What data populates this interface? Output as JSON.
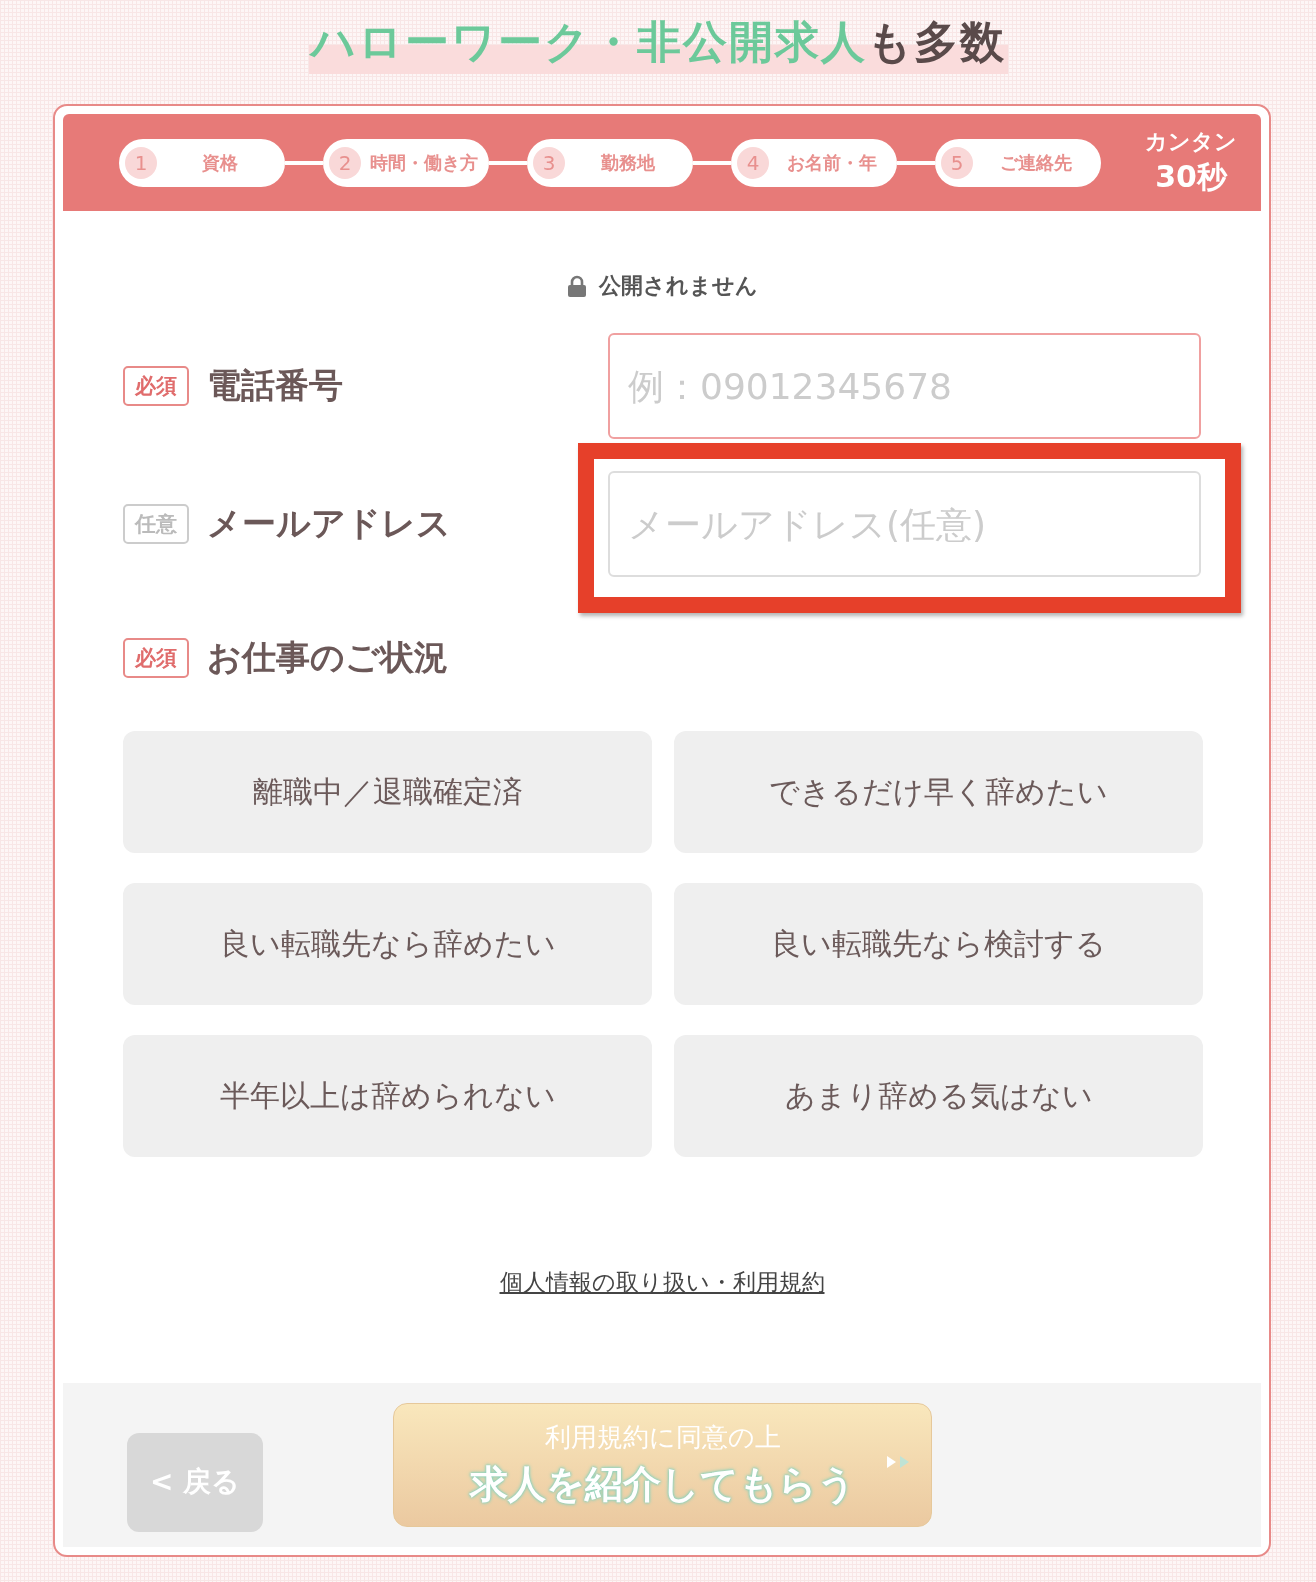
{
  "headline": {
    "highlight": "ハローワーク・非公開求人",
    "rest": "も多数"
  },
  "steps": [
    {
      "number": "1",
      "label": "資格"
    },
    {
      "number": "2",
      "label": "時間・働き方"
    },
    {
      "number": "3",
      "label": "勤務地"
    },
    {
      "number": "4",
      "label": "お名前・年"
    },
    {
      "number": "5",
      "label": "ご連絡先"
    }
  ],
  "duration": {
    "line1": "カンタン",
    "line2": "30秒"
  },
  "privacy_note": "公開されません",
  "fields": [
    {
      "badge": "必須",
      "required": true,
      "label": "電話番号",
      "placeholder": "例：09012345678",
      "highlighted": false
    },
    {
      "badge": "任意",
      "required": false,
      "label": "メールアドレス",
      "placeholder": "メールアドレス(任意)",
      "highlighted": true
    }
  ],
  "status_section": {
    "badge": "必須",
    "required": true,
    "label": "お仕事のご状況"
  },
  "options": [
    {
      "label": "離職中／退職確定済",
      "selected": false
    },
    {
      "label": "できるだけ早く辞めたい",
      "selected": false
    },
    {
      "label": "良い転職先なら辞めたい",
      "selected": false
    },
    {
      "label": "良い転職先なら検討する",
      "selected": false
    },
    {
      "label": "半年以上は辞められない",
      "selected": false
    },
    {
      "label": "あまり辞める気はない",
      "selected": false
    }
  ],
  "terms_link": "個人情報の取り扱い・利用規約",
  "back_button": {
    "arrow": "<",
    "label": "戻る"
  },
  "submit_button": {
    "subtitle": "利用規約に同意の上",
    "label": "求人を紹介してもらう"
  }
}
